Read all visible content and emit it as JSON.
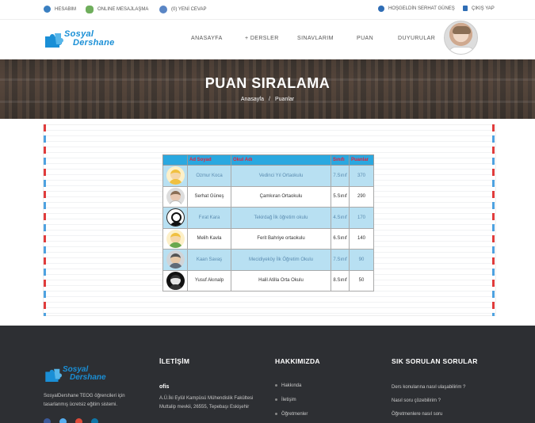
{
  "topbar": {
    "account": "HESABIM",
    "online_messaging": "ONLINE MESAJLAŞMA",
    "new_replies": "(0) YENİ CEVAP",
    "welcome": "HOŞGELDİN SERHAT GÜNEŞ",
    "logout": "ÇIKIŞ YAP"
  },
  "brand": {
    "line1": "Sosyal",
    "line2": "Dershane"
  },
  "nav": {
    "home": "ANASAYFA",
    "courses": "+ DERSLER",
    "exams": "SINAVLARIM",
    "points": "PUAN",
    "announcements": "DUYURULAR"
  },
  "banner": {
    "title": "PUAN SIRALAMA",
    "breadcrumb": [
      "Anasayfa",
      "/",
      "Puanlar"
    ]
  },
  "ranking": {
    "headers": [
      "Ad Soyad",
      "Okul Adı",
      "Sınıfı",
      "Puanlar"
    ],
    "rows": [
      {
        "name": "Ozmur Koca",
        "school": "Vedinci Yıl Ortaokulu",
        "grade": "7.Sınıf",
        "points": "370",
        "avatar": "blonde-avatar"
      },
      {
        "name": "Serhat Güneş",
        "school": "Çamkıran Ortaokulu",
        "grade": "5.Sınıf",
        "points": "290",
        "avatar": "photo-avatar"
      },
      {
        "name": "Fırat Kara",
        "school": "Tekirdağ İlk öğretim okulu",
        "grade": "4.Sınıf",
        "points": "170",
        "avatar": "glasses-avatar"
      },
      {
        "name": "Melih Kavla",
        "school": "Ferit Bahriye ortaokulu",
        "grade": "6.Sınıf",
        "points": "140",
        "avatar": "blonde-avatar"
      },
      {
        "name": "Kaan Savaş",
        "school": "Mecidiyeköy İlk Öğretim Okulu",
        "grade": "7.Sınıf",
        "points": "90",
        "avatar": "gray-avatar"
      },
      {
        "name": "Yusuf Akınalp",
        "school": "Halil Atilla Orta Okulu",
        "grade": "8.Sınıf",
        "points": "50",
        "avatar": "dark-avatar"
      }
    ]
  },
  "footer": {
    "about_text": "SosyalDershane TEOG öğrencileri için tasarlanmış ücretsiz eğitim sistemi.",
    "contact": {
      "title": "İLETİŞİM",
      "label": "ofis",
      "address": "A.Ü.İki Eylül Kampüsü Mühendislik Fakültesi Muttalip mevkii, 26555, Tepebaşı Eskişehir"
    },
    "about": {
      "title": "HAKKIMIZDA",
      "links": [
        "Hakkında",
        "İletişim",
        "Öğretmenler"
      ]
    },
    "faq": {
      "title": "SIK SORULAN SORULAR",
      "links": [
        "Ders konularına nasıl ulaşabilirim ?",
        "Nasıl soru çözebilirim ?",
        "Öğretmenlere nasıl soru"
      ]
    }
  },
  "colors": {
    "accent": "#2aa8e0",
    "header_text": "#e8213a",
    "alt_row": "#b8e0f2",
    "footer_bg": "#2d2f33"
  }
}
